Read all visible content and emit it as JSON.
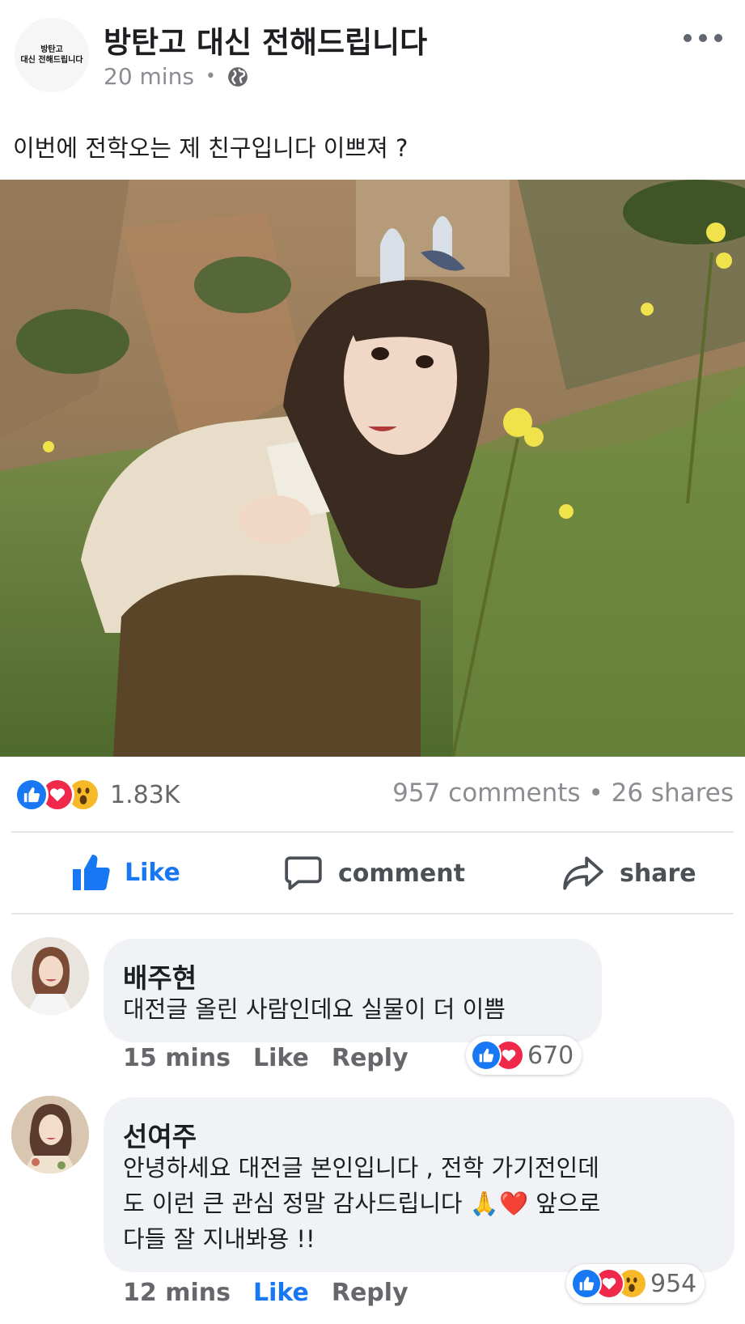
{
  "post": {
    "page_name": "방탄고 대신 전해드립니다",
    "avatar_text_line1": "방탄고",
    "avatar_text_line2": "대신 전해드립니다",
    "time": "20 mins",
    "separator": "•",
    "privacy_icon": "globe-icon",
    "text": "이번에 전학오는 제 친구입니다 이쁘져 ?",
    "photo_description": "girl-crouching-in-grassy-field-photo"
  },
  "reactions": {
    "icons": [
      "like-icon",
      "love-icon",
      "wow-icon"
    ],
    "count": "1.83K",
    "comments": "957 comments",
    "separator": "•",
    "shares": "26 shares"
  },
  "actions": {
    "like": "Like",
    "comment": "comment",
    "share": "share"
  },
  "comments": [
    {
      "name": "배주현",
      "lines": [
        "대전글 올린 사람인데요 실물이 더 이쁨"
      ],
      "time": "15 mins",
      "like": "Like",
      "reply": "Reply",
      "liked": false,
      "reaction_icons": [
        "like-icon",
        "love-icon"
      ],
      "reaction_count": "670"
    },
    {
      "name": "선여주",
      "lines": [
        "안녕하세요 대전글 본인입니다 , 전학 가기전인데",
        "도 이런 큰 관심 정말 감사드립니다 🙏❤️ 앞으로",
        "다들 잘 지내봐용 !!"
      ],
      "time": "12 mins",
      "like": "Like",
      "reply": "Reply",
      "liked": true,
      "reaction_icons": [
        "like-icon",
        "love-icon",
        "wow-icon"
      ],
      "reaction_count": "954"
    }
  ],
  "colors": {
    "brand_blue": "#1877f2",
    "love_red": "#f0284a",
    "wow_yellow": "#f7b928",
    "bubble_gray": "#f0f2f5",
    "meta_gray": "#8a8d91"
  }
}
